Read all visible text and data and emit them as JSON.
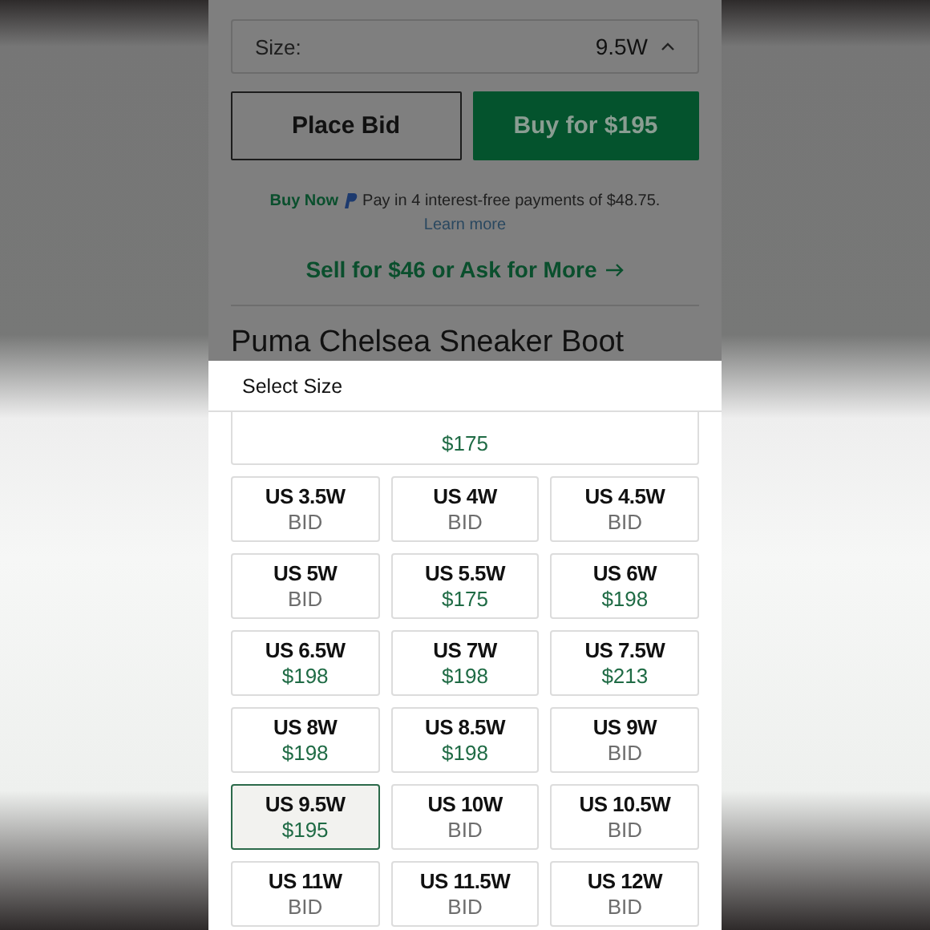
{
  "size_field": {
    "label": "Size:",
    "value": "9.5W",
    "expanded": true
  },
  "buttons": [
    {
      "label": "Place Bid",
      "kind": "outline"
    },
    {
      "label": "Buy for $195",
      "kind": "primary"
    }
  ],
  "paypal": {
    "brand": "Buy Now",
    "text": "Pay in 4 interest-free payments of $48.75.",
    "link": "Learn more"
  },
  "sell_link": "Sell for $46 or Ask for More",
  "product_title": "Puma Chelsea Sneaker Boot",
  "sheet": {
    "title": "Select Size",
    "partial_card_price": "$175",
    "sizes": [
      {
        "size": "US 3.5W",
        "price": "BID",
        "kind": "bid",
        "selected": false
      },
      {
        "size": "US 4W",
        "price": "BID",
        "kind": "bid",
        "selected": false
      },
      {
        "size": "US 4.5W",
        "price": "BID",
        "kind": "bid",
        "selected": false
      },
      {
        "size": "US 5W",
        "price": "BID",
        "kind": "bid",
        "selected": false
      },
      {
        "size": "US 5.5W",
        "price": "$175",
        "kind": "price",
        "selected": false
      },
      {
        "size": "US 6W",
        "price": "$198",
        "kind": "price",
        "selected": false
      },
      {
        "size": "US 6.5W",
        "price": "$198",
        "kind": "price",
        "selected": false
      },
      {
        "size": "US 7W",
        "price": "$198",
        "kind": "price",
        "selected": false
      },
      {
        "size": "US 7.5W",
        "price": "$213",
        "kind": "price",
        "selected": false
      },
      {
        "size": "US 8W",
        "price": "$198",
        "kind": "price",
        "selected": false
      },
      {
        "size": "US 8.5W",
        "price": "$198",
        "kind": "price",
        "selected": false
      },
      {
        "size": "US 9W",
        "price": "BID",
        "kind": "bid",
        "selected": false
      },
      {
        "size": "US 9.5W",
        "price": "$195",
        "kind": "price",
        "selected": true
      },
      {
        "size": "US 10W",
        "price": "BID",
        "kind": "bid",
        "selected": false
      },
      {
        "size": "US 10.5W",
        "price": "BID",
        "kind": "bid",
        "selected": false
      },
      {
        "size": "US 11W",
        "price": "BID",
        "kind": "bid",
        "selected": false
      },
      {
        "size": "US 11.5W",
        "price": "BID",
        "kind": "bid",
        "selected": false
      },
      {
        "size": "US 12W",
        "price": "BID",
        "kind": "bid",
        "selected": false
      }
    ]
  }
}
